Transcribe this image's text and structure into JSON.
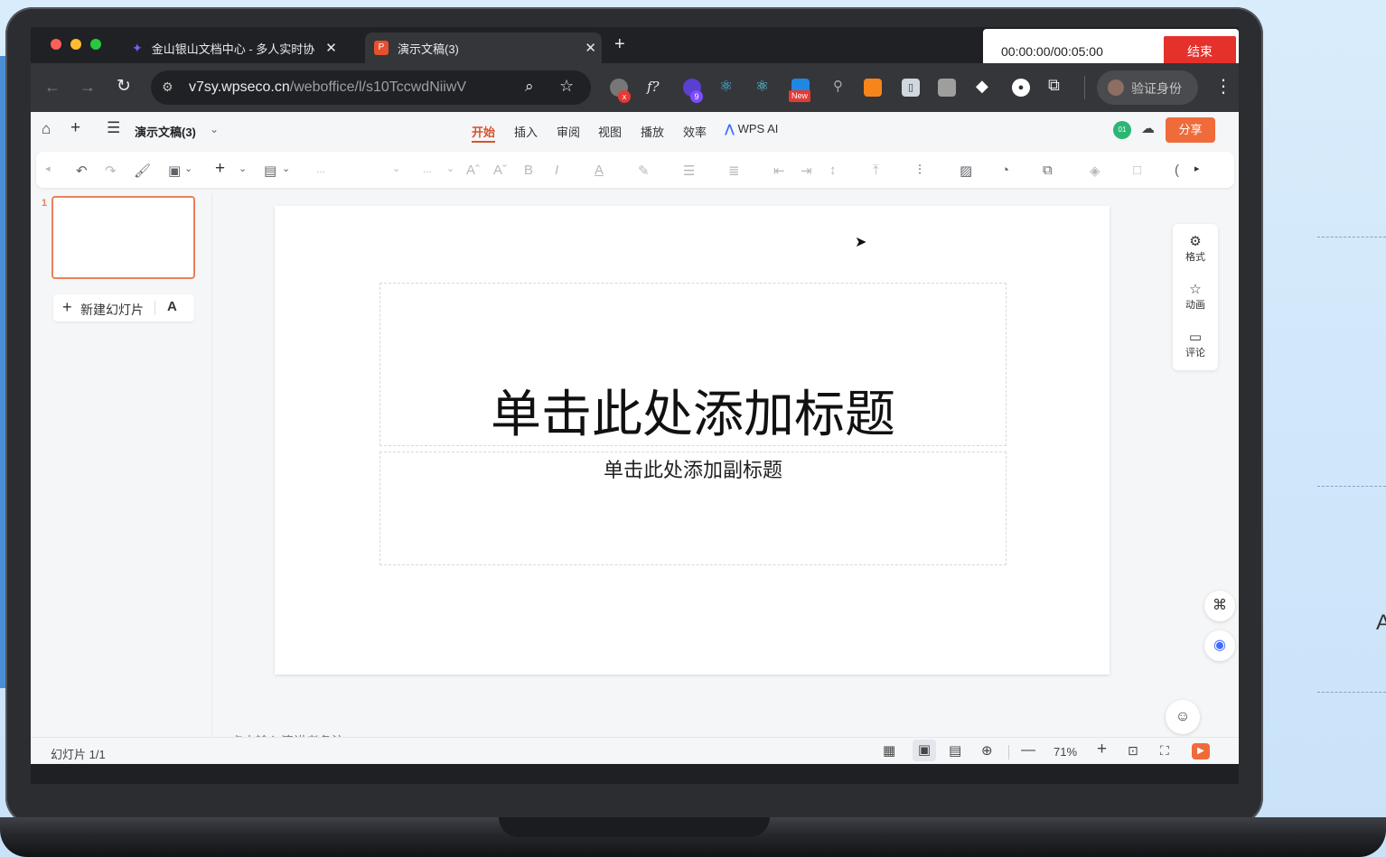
{
  "browser": {
    "tabs": [
      {
        "title": "金山银山文档中心 - 多人实时协",
        "active": false
      },
      {
        "title": "演示文稿(3)",
        "active": true
      }
    ],
    "new_tab": "+",
    "url_host": "v7sy.wpseco.cn",
    "url_path": "/weboffice/l/s10TccwdNiiwV",
    "verify_label": "验证身份",
    "ext_badge_new": "New",
    "ext_badge_nine": "9",
    "ext_badge_x": "x",
    "ext_fx": "f?"
  },
  "recorder": {
    "time": "00:00:00/00:05:00",
    "stop_label": "结束"
  },
  "wps": {
    "doc_title": "演示文稿(3)",
    "menu": [
      "开始",
      "插入",
      "审阅",
      "视图",
      "播放",
      "效率"
    ],
    "active_menu": "开始",
    "ai_label": "WPS AI",
    "share_label": "分享",
    "avatar_initials": "01",
    "new_slide_label": "新建幻灯片",
    "slide_number": "1",
    "title_placeholder": "单击此处添加标题",
    "subtitle_placeholder": "单击此处添加副标题",
    "right_panel": [
      "格式",
      "动画",
      "评论"
    ],
    "notes_placeholder": "点击输入演讲者备注",
    "status_slide": "幻灯片 1/1",
    "zoom": "71%",
    "ribbon_ellipsis": "..."
  },
  "colors": {
    "accent": "#d6532c",
    "share": "#ef6b3a",
    "stop": "#e5312c",
    "thumb_border": "#e8825b"
  }
}
